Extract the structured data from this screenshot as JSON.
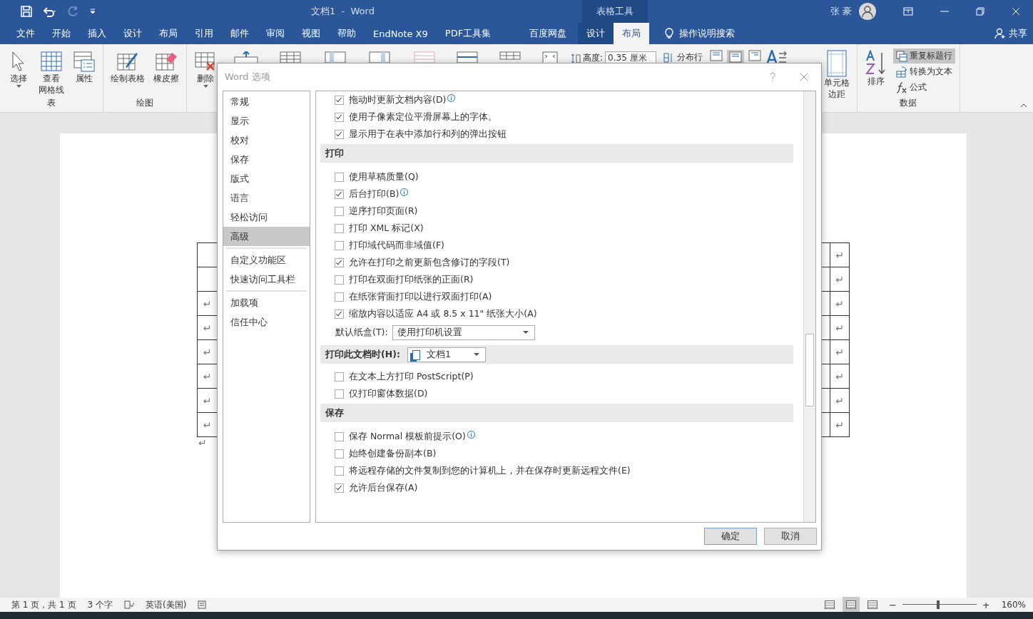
{
  "title_bar": {
    "title": "文档1  -  Word",
    "context_label": "表格工具",
    "user": "张 豪"
  },
  "tabs": [
    {
      "label": "文件",
      "selected": false
    },
    {
      "label": "开始",
      "selected": false
    },
    {
      "label": "插入",
      "selected": false
    },
    {
      "label": "设计",
      "selected": false
    },
    {
      "label": "布局",
      "selected": false
    },
    {
      "label": "引用",
      "selected": false
    },
    {
      "label": "邮件",
      "selected": false
    },
    {
      "label": "审阅",
      "selected": false
    },
    {
      "label": "视图",
      "selected": false
    },
    {
      "label": "帮助",
      "selected": false
    },
    {
      "label": "EndNote X9",
      "selected": false
    },
    {
      "label": "PDF工具集",
      "selected": false
    },
    {
      "label": "百度网盘",
      "selected": false
    },
    {
      "label": "设计",
      "selected": false
    },
    {
      "label": "布局",
      "selected": true
    }
  ],
  "tell_me": "操作说明搜索",
  "share": "共享",
  "ribbon": {
    "groups": [
      {
        "label": "表",
        "buttons": [
          {
            "lines": [
              "选择"
            ],
            "dropdown": true
          },
          {
            "lines": [
              "查看",
              "网格线"
            ]
          },
          {
            "lines": [
              "属性"
            ]
          }
        ]
      },
      {
        "label": "绘图",
        "buttons": [
          {
            "lines": [
              "绘制表格"
            ]
          },
          {
            "lines": [
              "橡皮擦"
            ]
          }
        ]
      }
    ],
    "delete": {
      "lines": [
        "删除"
      ],
      "dropdown": true
    },
    "height_label": "高度:",
    "height_value": "0.35 厘米",
    "distribute_rows": "分布行",
    "cell_margins": [
      "单元格",
      "边距"
    ],
    "data_group": {
      "label": "数据",
      "sort": "排序",
      "commands": [
        {
          "label": "重复标题行",
          "selected": true
        },
        {
          "label": "转换为文本",
          "selected": false
        },
        {
          "label": "公式",
          "selected": false
        }
      ]
    }
  },
  "document": {
    "rows": [
      {
        "right": "↵"
      },
      {
        "right": "↵"
      },
      {
        "left": "↵",
        "right": "↵"
      },
      {
        "left": "↵",
        "right": "↵"
      },
      {
        "left": "↵",
        "right": "↵"
      },
      {
        "left": "↵",
        "right": "↵"
      },
      {
        "left": "↵",
        "right": "↵"
      },
      {
        "left": "↵",
        "right": "↵"
      }
    ],
    "end_mark": "↵"
  },
  "dialog": {
    "title": "Word 选项",
    "nav_groups": [
      {
        "items": [
          {
            "label": "常规",
            "selected": false
          },
          {
            "label": "显示",
            "selected": false
          },
          {
            "label": "校对",
            "selected": false
          },
          {
            "label": "保存",
            "selected": false
          },
          {
            "label": "版式",
            "selected": false
          },
          {
            "label": "语言",
            "selected": false
          },
          {
            "label": "轻松访问",
            "selected": false
          },
          {
            "label": "高级",
            "selected": true
          }
        ]
      },
      {
        "items": [
          {
            "label": "自定义功能区",
            "selected": false
          },
          {
            "label": "快速访问工具栏",
            "selected": false
          }
        ]
      },
      {
        "items": [
          {
            "label": "加载项",
            "selected": false
          },
          {
            "label": "信任中心",
            "selected": false
          }
        ]
      }
    ],
    "rows": [
      {
        "kind": "checkbox",
        "label": "拖动时更新文档内容(D)",
        "checked": true,
        "info": true
      },
      {
        "kind": "checkbox",
        "label": "使用子像素定位平滑屏幕上的字体。",
        "checked": true
      },
      {
        "kind": "checkbox",
        "label": "显示用于在表中添加行和列的弹出按钮",
        "checked": true
      },
      {
        "kind": "section",
        "label": "打印"
      },
      {
        "kind": "checkbox",
        "label": "使用草稿质量(Q)",
        "checked": false
      },
      {
        "kind": "checkbox",
        "label": "后台打印(B)",
        "checked": true,
        "info": true
      },
      {
        "kind": "checkbox",
        "label": "逆序打印页面(R)",
        "checked": false
      },
      {
        "kind": "checkbox",
        "label": "打印 XML 标记(X)",
        "checked": false
      },
      {
        "kind": "checkbox",
        "label": "打印域代码而非域值(F)",
        "checked": false
      },
      {
        "kind": "checkbox",
        "label": "允许在打印之前更新包含修订的字段(T)",
        "checked": true
      },
      {
        "kind": "checkbox",
        "label": "打印在双面打印纸张的正面(R)",
        "checked": false
      },
      {
        "kind": "checkbox",
        "label": "在纸张背面打印以进行双面打印(A)",
        "checked": false
      },
      {
        "kind": "checkbox",
        "label": "缩放内容以适应 A4 或 8.5 x 11\" 纸张大小(A)",
        "checked": true
      },
      {
        "kind": "select",
        "label": "默认纸盒(T):",
        "value": "使用打印机设置"
      },
      {
        "kind": "section_select",
        "label": "打印此文档时(H):",
        "value": "文档1"
      },
      {
        "kind": "checkbox",
        "label": "在文本上方打印 PostScript(P)",
        "checked": false
      },
      {
        "kind": "checkbox",
        "label": "仅打印窗体数据(D)",
        "checked": false
      },
      {
        "kind": "section",
        "label": "保存"
      },
      {
        "kind": "checkbox",
        "label": "保存 Normal 模板前提示(O)",
        "checked": false,
        "info": true
      },
      {
        "kind": "checkbox",
        "label": "始终创建备份副本(B)",
        "checked": false
      },
      {
        "kind": "checkbox",
        "label": "将远程存储的文件复制到您的计算机上，并在保存时更新远程文件(E)",
        "checked": false
      },
      {
        "kind": "checkbox",
        "label": "允许后台保存(A)",
        "checked": true
      }
    ],
    "ok": "确定",
    "cancel": "取消"
  },
  "status_bar": {
    "page": "第 1 页，共 1 页",
    "words": "3 个字",
    "language": "英语(美国)",
    "views": [
      {
        "selected": false
      },
      {
        "selected": true
      },
      {
        "selected": false
      }
    ],
    "zoom_out": "−",
    "zoom_in": "+",
    "zoom": {
      "level": 0.46,
      "reading": "160%"
    }
  }
}
